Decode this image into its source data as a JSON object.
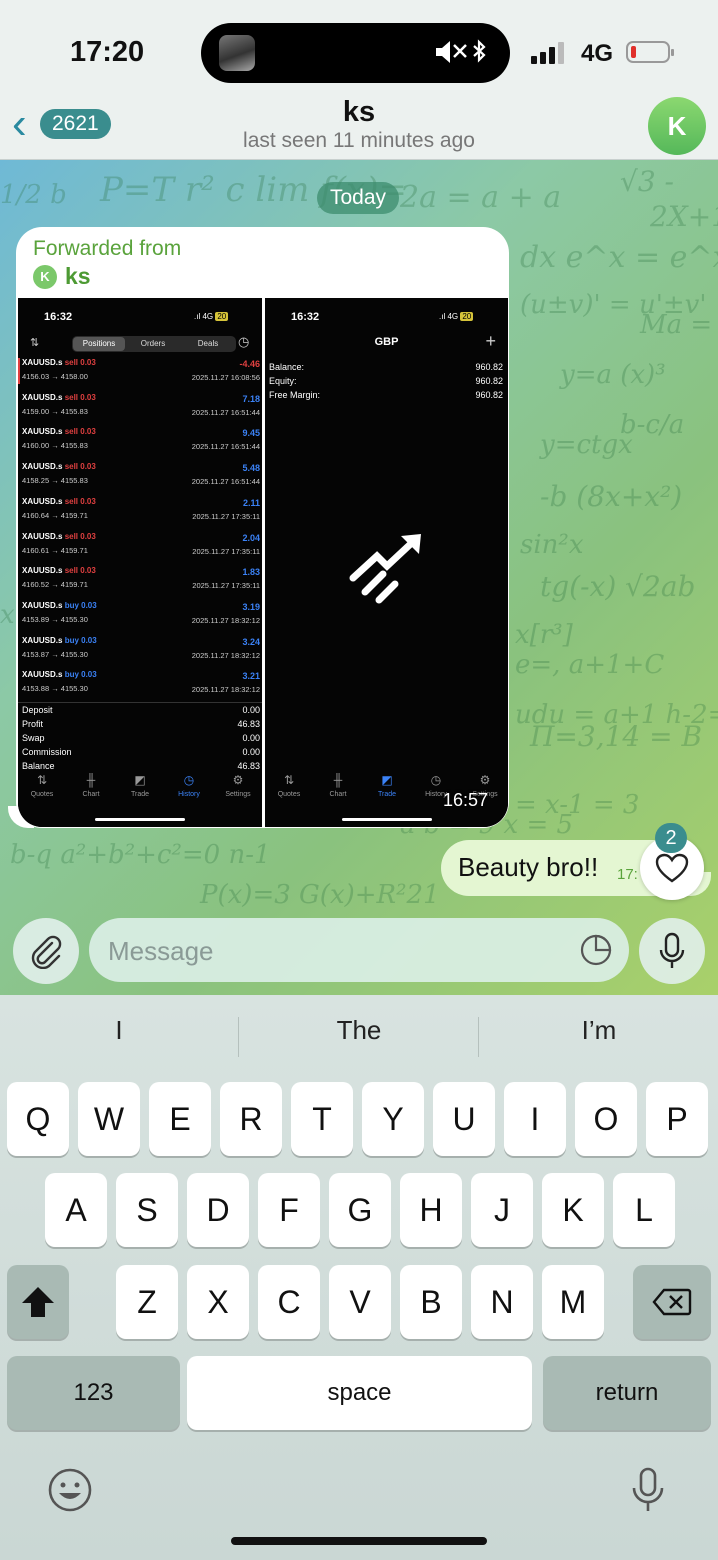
{
  "status": {
    "time": "17:20",
    "network": "4G"
  },
  "header": {
    "back_count": "2621",
    "title": "ks",
    "subtitle": "last seen 11 minutes ago",
    "avatar_letter": "K"
  },
  "chat": {
    "date_label": "Today",
    "forwarded": {
      "label": "Forwarded from",
      "avatar_letter": "K",
      "name": "ks",
      "time": "16:57",
      "left_screen": {
        "time": "16:32",
        "network": "4G",
        "battery": "20",
        "segments": [
          "Positions",
          "Orders",
          "Deals"
        ],
        "rows": [
          {
            "symbol": "XAUUSD.s",
            "side": "sell 0.03",
            "prices": "4156.03 → 4158.00",
            "profit": "-4.46",
            "date": "2025.11.27 16:08:56"
          },
          {
            "symbol": "XAUUSD.s",
            "side": "sell 0.03",
            "prices": "4159.00 → 4155.83",
            "profit": "7.18",
            "date": "2025.11.27 16:51:44"
          },
          {
            "symbol": "XAUUSD.s",
            "side": "sell 0.03",
            "prices": "4160.00 → 4155.83",
            "profit": "9.45",
            "date": "2025.11.27 16:51:44"
          },
          {
            "symbol": "XAUUSD.s",
            "side": "sell 0.03",
            "prices": "4158.25 → 4155.83",
            "profit": "5.48",
            "date": "2025.11.27 16:51:44"
          },
          {
            "symbol": "XAUUSD.s",
            "side": "sell 0.03",
            "prices": "4160.64 → 4159.71",
            "profit": "2.11",
            "date": "2025.11.27 17:35:11"
          },
          {
            "symbol": "XAUUSD.s",
            "side": "sell 0.03",
            "prices": "4160.61 → 4159.71",
            "profit": "2.04",
            "date": "2025.11.27 17:35:11"
          },
          {
            "symbol": "XAUUSD.s",
            "side": "sell 0.03",
            "prices": "4160.52 → 4159.71",
            "profit": "1.83",
            "date": "2025.11.27 17:35:11"
          },
          {
            "symbol": "XAUUSD.s",
            "side": "buy 0.03",
            "prices": "4153.89 → 4155.30",
            "profit": "3.19",
            "date": "2025.11.27 18:32:12"
          },
          {
            "symbol": "XAUUSD.s",
            "side": "buy 0.03",
            "prices": "4153.87 → 4155.30",
            "profit": "3.24",
            "date": "2025.11.27 18:32:12"
          },
          {
            "symbol": "XAUUSD.s",
            "side": "buy 0.03",
            "prices": "4153.88 → 4155.30",
            "profit": "3.21",
            "date": "2025.11.27 18:32:12"
          }
        ],
        "summary": [
          {
            "label": "Deposit",
            "value": "0.00"
          },
          {
            "label": "Profit",
            "value": "46.83"
          },
          {
            "label": "Swap",
            "value": "0.00"
          },
          {
            "label": "Commission",
            "value": "0.00"
          },
          {
            "label": "Balance",
            "value": "46.83"
          }
        ],
        "tabs": [
          "Quotes",
          "Chart",
          "Trade",
          "History",
          "Settings"
        ],
        "active_tab": "History"
      },
      "right_screen": {
        "time": "16:32",
        "network": "4G",
        "battery": "20",
        "currency": "GBP",
        "account": [
          {
            "label": "Balance:",
            "value": "960.82"
          },
          {
            "label": "Equity:",
            "value": "960.82"
          },
          {
            "label": "Free Margin:",
            "value": "960.82"
          }
        ],
        "tabs": [
          "Quotes",
          "Chart",
          "Trade",
          "History",
          "Settings"
        ],
        "active_tab": "Trade"
      }
    },
    "outgoing": {
      "text": "Beauty bro!!",
      "time": "17:",
      "reaction_count": "2"
    }
  },
  "composer": {
    "placeholder": "Message"
  },
  "keyboard": {
    "suggestions": [
      "I",
      "The",
      "I’m"
    ],
    "row1": [
      "Q",
      "W",
      "E",
      "R",
      "T",
      "Y",
      "U",
      "I",
      "O",
      "P"
    ],
    "row2": [
      "A",
      "S",
      "D",
      "F",
      "G",
      "H",
      "J",
      "K",
      "L"
    ],
    "row3": [
      "Z",
      "X",
      "C",
      "V",
      "B",
      "N",
      "M"
    ],
    "numbers_label": "123",
    "space_label": "space",
    "return_label": "return"
  },
  "colors": {
    "accent": "#3a8d8e",
    "bubble_out": "#e4f6d2",
    "loss": "#e04040",
    "gain": "#3b82f6"
  }
}
